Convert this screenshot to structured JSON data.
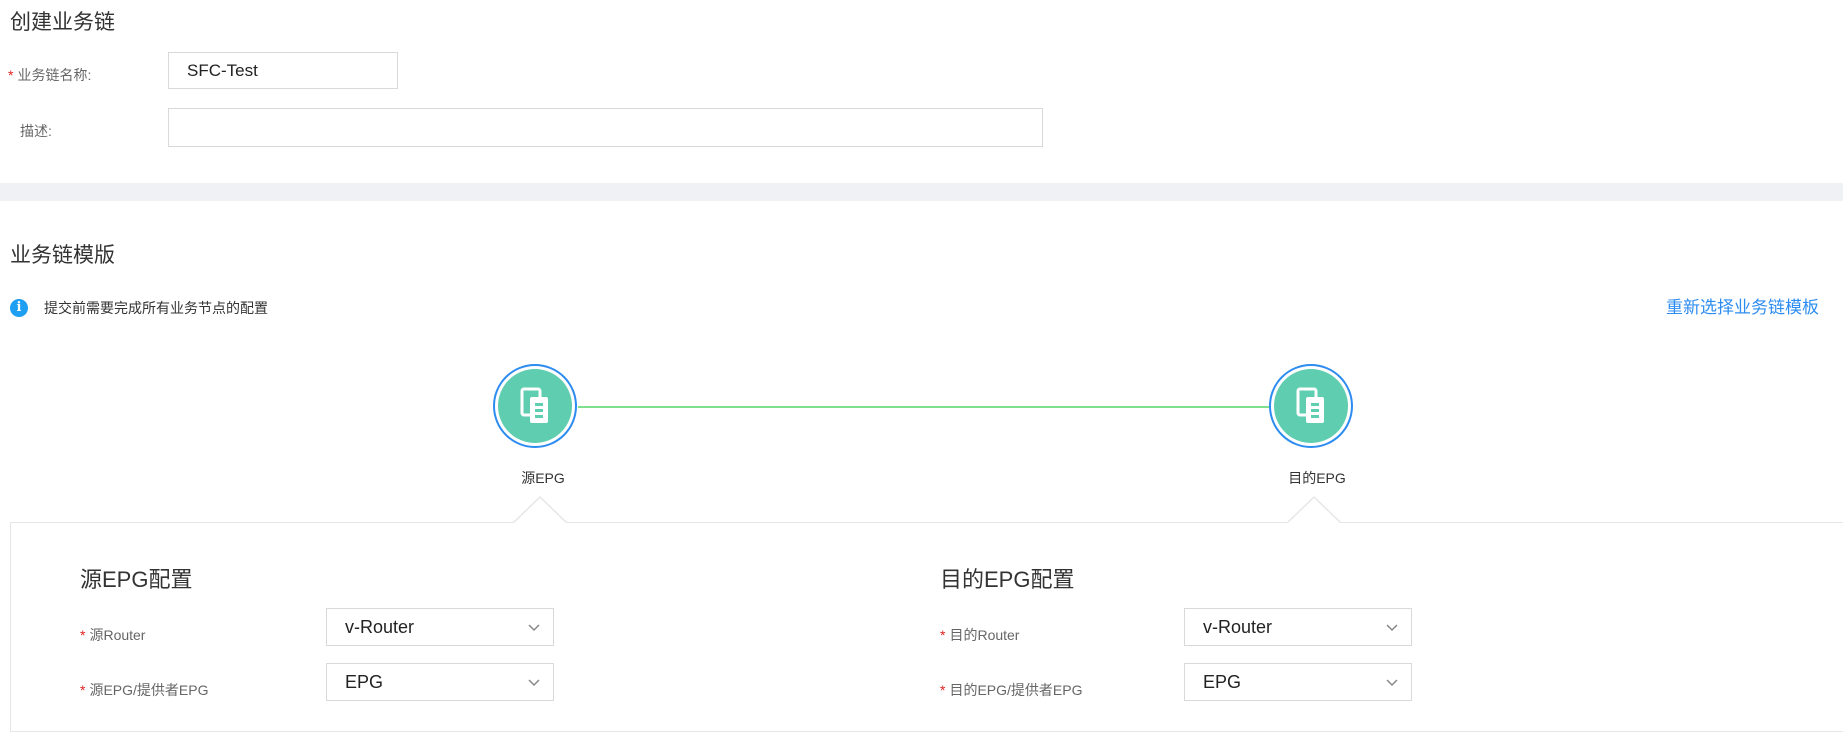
{
  "form": {
    "title": "创建业务链",
    "name_label": "业务链名称:",
    "name_value": "SFC-Test",
    "desc_label": "描述:",
    "desc_value": ""
  },
  "template": {
    "title": "业务链模版",
    "notice": "提交前需要完成所有业务节点的配置",
    "reselect_link": "重新选择业务链模板",
    "nodes": [
      {
        "label": "源EPG",
        "icon": "server-icon"
      },
      {
        "label": "目的EPG",
        "icon": "server-icon"
      }
    ]
  },
  "source_config": {
    "title": "源EPG配置",
    "router_label": "源Router",
    "router_value": "v-Router",
    "epg_label": "源EPG/提供者EPG",
    "epg_value": "EPG"
  },
  "dest_config": {
    "title": "目的EPG配置",
    "router_label": "目的Router",
    "router_value": "v-Router",
    "epg_label": "目的EPG/提供者EPG",
    "epg_value": "EPG"
  },
  "colors": {
    "accent": "#2d8cf0",
    "node_fill": "#5fcdb0",
    "link_line": "#7ee08a",
    "required": "#e02020"
  }
}
